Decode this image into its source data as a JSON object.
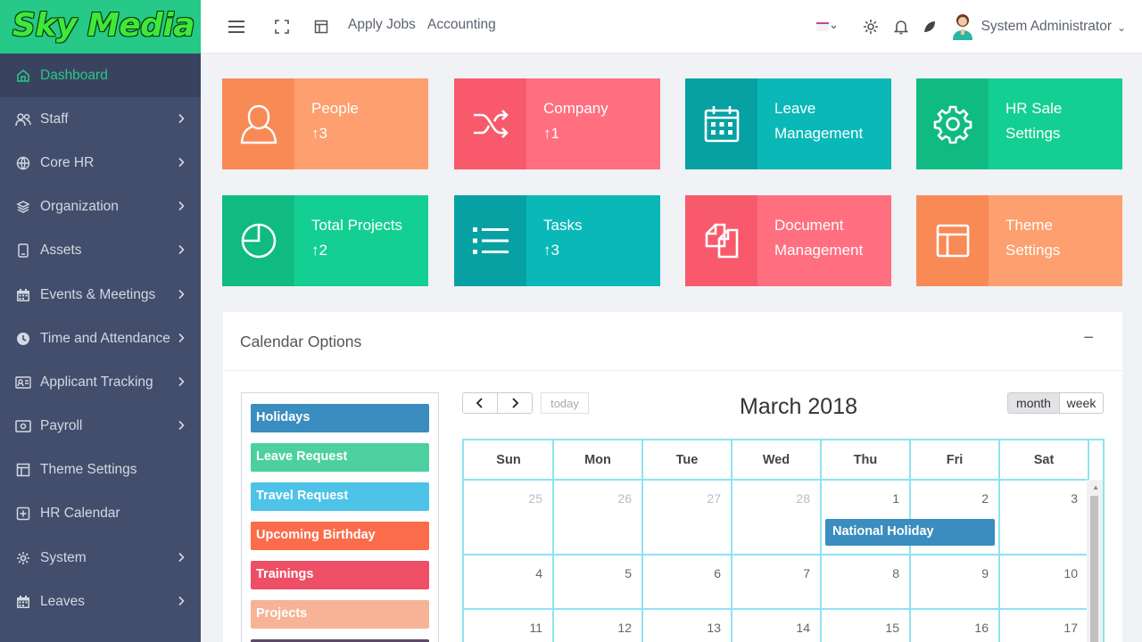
{
  "watermark": "Sky Media",
  "header": {
    "links": [
      "Apply Jobs",
      "Accounting"
    ],
    "user": "System Administrator"
  },
  "sidebar": {
    "items": [
      {
        "label": "Dashboard",
        "icon": "home-icon",
        "active": true,
        "chevron": false
      },
      {
        "label": "Staff",
        "icon": "users-icon",
        "chevron": true
      },
      {
        "label": "Core HR",
        "icon": "globe-icon",
        "chevron": true
      },
      {
        "label": "Organization",
        "icon": "layers-icon",
        "chevron": true
      },
      {
        "label": "Assets",
        "icon": "device-icon",
        "chevron": true
      },
      {
        "label": "Events & Meetings",
        "icon": "calendar-icon",
        "chevron": true
      },
      {
        "label": "Time and Attendance",
        "icon": "clock-icon",
        "chevron": true
      },
      {
        "label": "Applicant Tracking",
        "icon": "id-card-icon",
        "chevron": true
      },
      {
        "label": "Payroll",
        "icon": "money-icon",
        "chevron": true
      },
      {
        "label": "Theme Settings",
        "icon": "layout-icon",
        "chevron": false
      },
      {
        "label": "HR Calendar",
        "icon": "plus-square-icon",
        "chevron": false
      },
      {
        "label": "System",
        "icon": "gear-icon",
        "chevron": true
      },
      {
        "label": "Leaves",
        "icon": "calendar-icon",
        "chevron": true
      }
    ]
  },
  "tiles": [
    {
      "line1": "People",
      "line2": "↑3",
      "color": "#fd9f6e",
      "icon": "user-icon"
    },
    {
      "line1": "Company",
      "line2": "↑1",
      "color": "#ff6f80",
      "icon": "shuffle-icon"
    },
    {
      "line1": "Leave",
      "line2": "Management",
      "color": "#0ab8b8",
      "icon": "calendar-icon"
    },
    {
      "line1": "HR Sale",
      "line2": "Settings",
      "color": "#14cf92",
      "icon": "gear-icon"
    },
    {
      "line1": "Total Projects",
      "line2": "↑2",
      "color": "#14cf92",
      "icon": "pie-chart-icon"
    },
    {
      "line1": "Tasks",
      "line2": "↑3",
      "color": "#0ab8b8",
      "icon": "list-icon"
    },
    {
      "line1": "Document",
      "line2": "Management",
      "color": "#ff6f80",
      "icon": "documents-icon"
    },
    {
      "line1": "Theme",
      "line2": "Settings",
      "color": "#fd9f6e",
      "icon": "layout-icon"
    }
  ],
  "calendar": {
    "panel_title": "Calendar Options",
    "minimize": "−",
    "legend": [
      {
        "label": "Holidays",
        "color": "#3a8dbe"
      },
      {
        "label": "Leave Request",
        "color": "#4cd0a0"
      },
      {
        "label": "Travel Request",
        "color": "#4dc3e8"
      },
      {
        "label": "Upcoming Birthday",
        "color": "#fb6c4b"
      },
      {
        "label": "Trainings",
        "color": "#ee4e66"
      },
      {
        "label": "Projects",
        "color": "#f7b396"
      }
    ],
    "prev": "‹",
    "next": "›",
    "today": "today",
    "title": "March 2018",
    "views": [
      "month",
      "week"
    ],
    "days_of_week": [
      "Sun",
      "Mon",
      "Tue",
      "Wed",
      "Thu",
      "Fri",
      "Sat"
    ],
    "weeks": [
      [
        {
          "d": "25",
          "other": true
        },
        {
          "d": "26",
          "other": true
        },
        {
          "d": "27",
          "other": true
        },
        {
          "d": "28",
          "other": true
        },
        {
          "d": "1"
        },
        {
          "d": "2"
        },
        {
          "d": "3"
        }
      ],
      [
        {
          "d": "4"
        },
        {
          "d": "5"
        },
        {
          "d": "6"
        },
        {
          "d": "7"
        },
        {
          "d": "8"
        },
        {
          "d": "9"
        },
        {
          "d": "10"
        }
      ],
      [
        {
          "d": "11"
        },
        {
          "d": "12"
        },
        {
          "d": "13"
        },
        {
          "d": "14"
        },
        {
          "d": "15"
        },
        {
          "d": "16"
        },
        {
          "d": "17"
        }
      ]
    ],
    "event": {
      "label": "National Holiday",
      "color": "#3a8dbe"
    }
  }
}
